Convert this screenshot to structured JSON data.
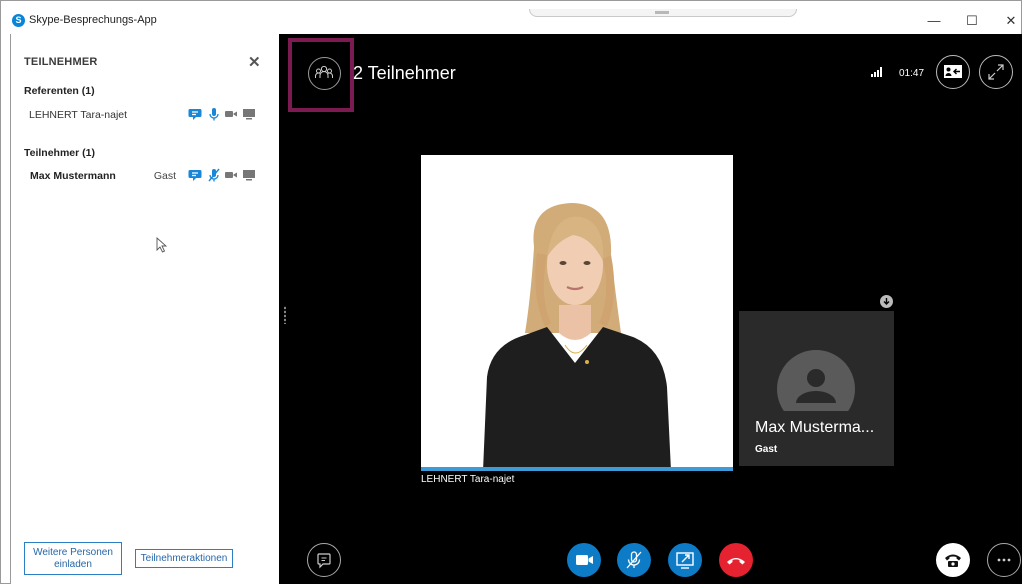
{
  "window": {
    "title": "Skype-Besprechungs-App",
    "logo_letter": "S",
    "minimize": "—",
    "maximize": "☐",
    "close": "✕"
  },
  "panel": {
    "title": "TEILNEHMER",
    "close_glyph": "✕",
    "presenters_heading": "Referenten (1)",
    "participants_heading": "Teilnehmer (1)",
    "presenters": [
      {
        "name": "LEHNERT Tara-najet",
        "icons": [
          "chat-icon",
          "microphone-icon",
          "video-icon",
          "screen-share-icon"
        ]
      }
    ],
    "participants": [
      {
        "name": "Max Mustermann",
        "role": "Gast",
        "icons": [
          "chat-icon",
          "microphone-muted-icon",
          "video-icon",
          "screen-share-icon"
        ]
      }
    ],
    "invite_button": "Weitere Personen einladen",
    "actions_button": "Teilnehmeraktionen"
  },
  "stage": {
    "participant_count": "2 Teilnehmer",
    "call_timer": "01:47",
    "main_speaker_name": "LEHNERT Tara-najet",
    "pip_name": "Max Musterma...",
    "pip_role": "Gast"
  },
  "colors": {
    "accent_blue": "#0e7bc6",
    "hangup_red": "#e5222f",
    "highlight": "#7b1b52",
    "active_speaker_bar": "#3d9bd6"
  }
}
